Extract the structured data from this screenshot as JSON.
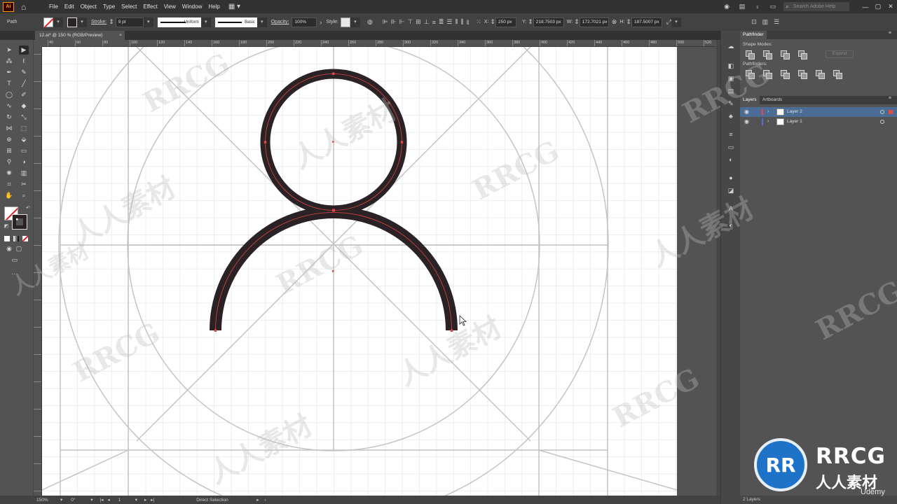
{
  "app": {
    "logo": "Ai"
  },
  "menu": [
    "File",
    "Edit",
    "Object",
    "Type",
    "Select",
    "Effect",
    "View",
    "Window",
    "Help"
  ],
  "search": {
    "placeholder": "Search Adobe Help"
  },
  "control_bar": {
    "selection_label": "Path",
    "stroke_label": "Stroke:",
    "stroke_weight": "9 pt",
    "profile": "Uniform",
    "brush": "Basic",
    "opacity_label": "Opacity:",
    "opacity_value": "100%",
    "style_label": "Style:",
    "x_label": "X:",
    "x_value": "250 px",
    "y_label": "Y:",
    "y_value": "218.7503 px",
    "w_label": "W:",
    "w_value": "172.7021 px",
    "h_label": "H:",
    "h_value": "187.5007 px"
  },
  "document_tab": {
    "title": "12.ai* @ 150 % (RGB/Preview)",
    "close": "×"
  },
  "ruler_labels": [
    "40",
    "60",
    "80",
    "100",
    "120",
    "140",
    "160",
    "180",
    "200",
    "220",
    "240",
    "260",
    "280",
    "300",
    "320",
    "340",
    "360",
    "380",
    "400",
    "420",
    "440",
    "460",
    "480",
    "500",
    "520"
  ],
  "status_bar": {
    "zoom": "150%",
    "rotation": "0°",
    "artboard": "1",
    "tool": "Direct Selection"
  },
  "pathfinder": {
    "tab": "Pathfinder",
    "shape_modes_label": "Shape Modes:",
    "pathfinders_label": "Pathfinders:",
    "expand_label": "Expand"
  },
  "layers_panel": {
    "tabs": [
      "Layers",
      "Artboards"
    ],
    "layers": [
      {
        "name": "Layer 2",
        "color": "#e04a4a",
        "selected": true
      },
      {
        "name": "Layer 1",
        "color": "#4a6ee0",
        "selected": false
      }
    ],
    "footer": "2 Layers"
  },
  "watermarks": {
    "latin": "RRCG",
    "cjk": "人人素材"
  },
  "brand": {
    "logo_text": "RR",
    "name": "RRCG",
    "subtitle": "人人素材"
  },
  "udemy": "Udemy",
  "colors": {
    "accent": "#4b6d95",
    "stroke_dark": "#2a2224",
    "path_red": "#e04545",
    "guide_gray": "#c4c4c4",
    "brand_blue": "#1e73c8"
  }
}
